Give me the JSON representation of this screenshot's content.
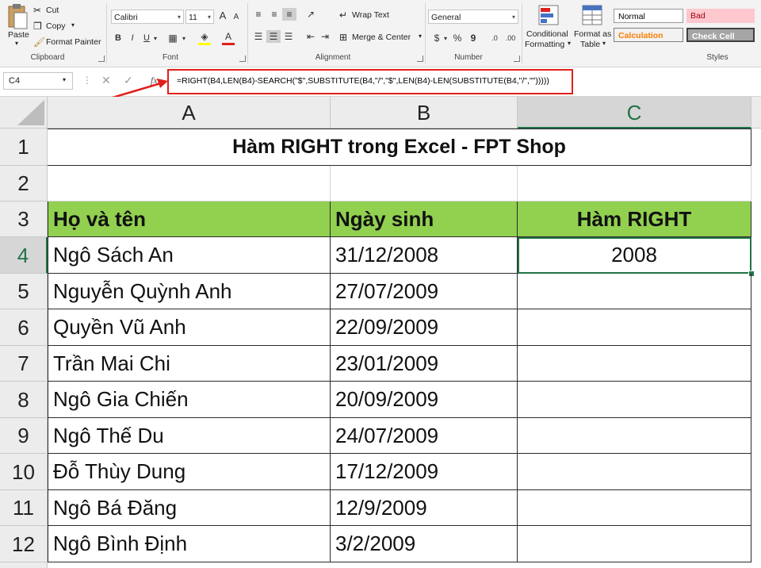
{
  "ribbon": {
    "clipboard": {
      "paste": "Paste",
      "cut": "Cut",
      "copy": "Copy",
      "format_painter": "Format Painter",
      "label": "Clipboard"
    },
    "font": {
      "name": "Calibri",
      "size": "11",
      "bold": "B",
      "italic": "I",
      "underline": "U",
      "grow": "A",
      "shrink": "A",
      "label": "Font"
    },
    "alignment": {
      "wrap_text": "Wrap Text",
      "merge_center": "Merge & Center",
      "label": "Alignment"
    },
    "number": {
      "format": "General",
      "currency": "$",
      "percent": "%",
      "comma": "9",
      "label": "Number"
    },
    "styles": {
      "conditional": "Conditional",
      "formatting": "Formatting",
      "format_as": "Format as",
      "table": "Table",
      "normal": "Normal",
      "bad": "Bad",
      "calculation": "Calculation",
      "check_cell": "Check Cell",
      "label": "Styles"
    }
  },
  "formula_bar": {
    "name_box": "C4",
    "fx": "fx",
    "formula": "=RIGHT(B4,LEN(B4)-SEARCH(\"$\",SUBSTITUTE(B4,\"/\",\"$\",LEN(B4)-LEN(SUBSTITUTE(B4,\"/\",\"\")))))"
  },
  "columns": [
    "A",
    "B",
    "C"
  ],
  "title": "Hàm RIGHT trong Excel - FPT Shop",
  "table": {
    "headers": [
      "Họ và tên",
      "Ngày sinh",
      "Hàm RIGHT"
    ],
    "rows": [
      {
        "row": "4",
        "name": "Ngô Sách An",
        "dob": "31/12/2008",
        "result": "2008"
      },
      {
        "row": "5",
        "name": "Nguyễn Quỳnh Anh",
        "dob": "27/07/2009",
        "result": ""
      },
      {
        "row": "6",
        "name": "Quyền Vũ Anh",
        "dob": "22/09/2009",
        "result": ""
      },
      {
        "row": "7",
        "name": "Trần Mai Chi",
        "dob": "23/01/2009",
        "result": ""
      },
      {
        "row": "8",
        "name": "Ngô Gia Chiến",
        "dob": "20/09/2009",
        "result": ""
      },
      {
        "row": "9",
        "name": "Ngô Thế Du",
        "dob": "24/07/2009",
        "result": ""
      },
      {
        "row": "10",
        "name": "Đỗ Thùy Dung",
        "dob": "17/12/2009",
        "result": ""
      },
      {
        "row": "11",
        "name": "Ngô Bá Đăng",
        "dob": "12/9/2009",
        "result": ""
      },
      {
        "row": "12",
        "name": "Ngô Bình Định",
        "dob": "3/2/2009",
        "result": ""
      }
    ]
  },
  "row_numbers_top": [
    "1",
    "2",
    "3"
  ],
  "colors": {
    "header_fill": "#92d050",
    "accent": "#217346",
    "annotation": "#e0201c"
  }
}
